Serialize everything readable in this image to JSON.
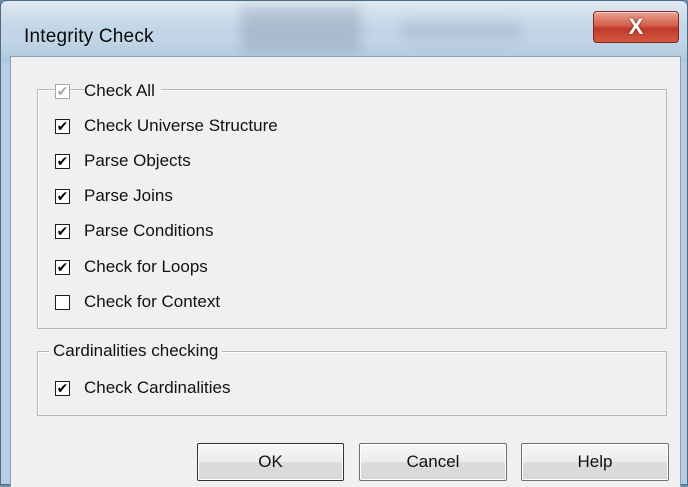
{
  "window": {
    "title": "Integrity Check",
    "close_glyph": "X"
  },
  "checks_group": {
    "items": [
      {
        "label": "Check All",
        "checked": true,
        "disabled": true
      },
      {
        "label": "Check Universe Structure",
        "checked": true,
        "disabled": false
      },
      {
        "label": "Parse Objects",
        "checked": true,
        "disabled": false
      },
      {
        "label": "Parse Joins",
        "checked": true,
        "disabled": false
      },
      {
        "label": "Parse Conditions",
        "checked": true,
        "disabled": false
      },
      {
        "label": "Check for Loops",
        "checked": true,
        "disabled": false
      },
      {
        "label": "Check for Context",
        "checked": false,
        "disabled": false
      }
    ]
  },
  "cardinalities_group": {
    "legend": "Cardinalities checking",
    "items": [
      {
        "label": "Check Cardinalities",
        "checked": true,
        "disabled": false
      }
    ]
  },
  "buttons": {
    "ok": "OK",
    "cancel": "Cancel",
    "help": "Help"
  },
  "icons": {
    "check_mark": "✔",
    "close": "close-icon"
  },
  "colors": {
    "close_button": "#c0392b",
    "dialog_background": "#f0f0f0",
    "title_bar": "#c9dcec"
  }
}
